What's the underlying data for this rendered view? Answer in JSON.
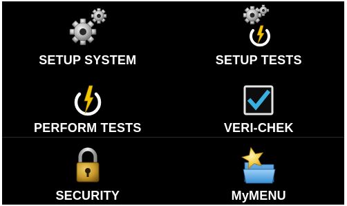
{
  "menu": {
    "items": [
      {
        "label": "SETUP SYSTEM",
        "icon": "gears-icon"
      },
      {
        "label": "SETUP TESTS",
        "icon": "gear-lightning-icon"
      },
      {
        "label": "PERFORM TESTS",
        "icon": "lightning-power-icon"
      },
      {
        "label": "VERI-CHEK",
        "icon": "checkbox-icon"
      },
      {
        "label": "SECURITY",
        "icon": "padlock-icon"
      },
      {
        "label": "MyMENU",
        "icon": "star-folder-icon"
      }
    ]
  },
  "colors": {
    "background": "#000000",
    "text": "#ffffff",
    "lightning": "#f5c400",
    "check": "#3ab0e0",
    "lock_gold": "#c89a2a",
    "star": "#f2cc4a",
    "folder": "#3a8fd6"
  }
}
